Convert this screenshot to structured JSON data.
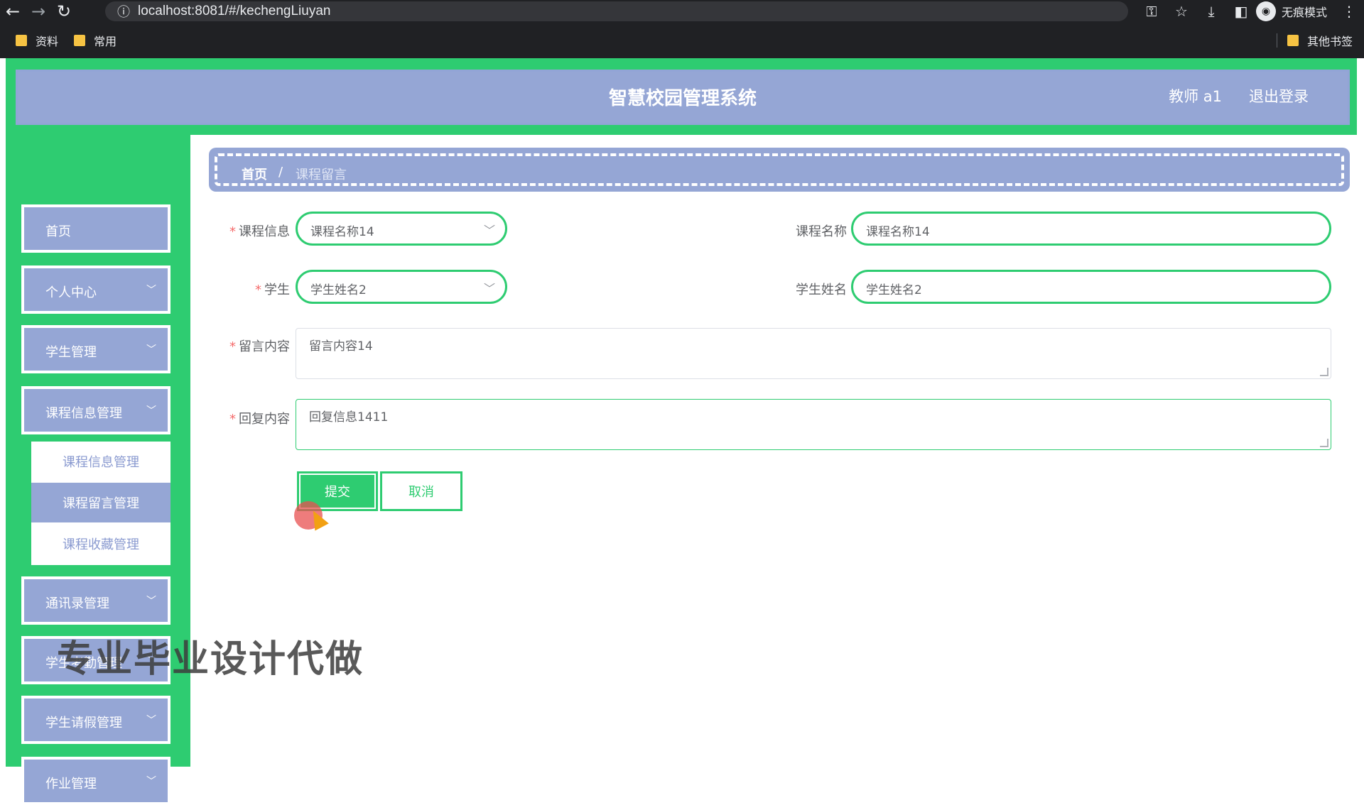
{
  "browser": {
    "url": "localhost:8081/#/kechengLiuyan",
    "incognito_label": "无痕模式",
    "bookmarks": [
      "资料",
      "常用"
    ],
    "other_bookmarks": "其他书签"
  },
  "header": {
    "title": "智慧校园管理系统",
    "user": "教师 a1",
    "logout": "退出登录"
  },
  "sidebar": {
    "items": [
      {
        "label": "首页",
        "has_chevron": false
      },
      {
        "label": "个人中心",
        "has_chevron": true
      },
      {
        "label": "学生管理",
        "has_chevron": true
      },
      {
        "label": "课程信息管理",
        "has_chevron": true
      },
      {
        "label": "通讯录管理",
        "has_chevron": true
      },
      {
        "label": "学生考勤管理",
        "has_chevron": true
      },
      {
        "label": "学生请假管理",
        "has_chevron": true
      },
      {
        "label": "作业管理",
        "has_chevron": true
      }
    ],
    "submenu": [
      "课程信息管理",
      "课程留言管理",
      "课程收藏管理"
    ],
    "submenu_active": "课程留言管理"
  },
  "breadcrumb": {
    "home": "首页",
    "separator": "/",
    "current": "课程留言"
  },
  "form": {
    "course_info_label": "课程信息",
    "course_info_value": "课程名称14",
    "course_name_label": "课程名称",
    "course_name_value": "课程名称14",
    "student_label": "学生",
    "student_value": "学生姓名2",
    "student_name_label": "学生姓名",
    "student_name_value": "学生姓名2",
    "message_label": "留言内容",
    "message_value": "留言内容14",
    "reply_label": "回复内容",
    "reply_value": "回复信息1411",
    "submit": "提交",
    "cancel": "取消",
    "required_mark": "*"
  },
  "watermark": "专业毕业设计代做",
  "colors": {
    "accent_green": "#2ecc71",
    "accent_blue": "#95a6d5"
  }
}
